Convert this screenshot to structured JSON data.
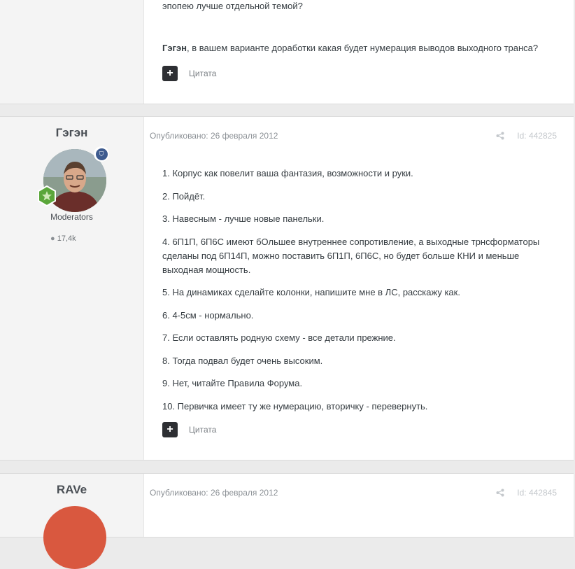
{
  "posts": [
    {
      "body_top": "эпопею лучше отдельной темой?",
      "reply_author": "Гэгэн",
      "reply_text": ", в вашем варианте доработки какая будет нумерация выводов выходного транса?",
      "quote_label": "Цитата"
    },
    {
      "author": "Гэгэн",
      "group": "Moderators",
      "posts_count": "17,4k",
      "date": "Опубликовано: 26 февраля 2012",
      "post_id": "Id: 442825",
      "paragraphs": [
        "1. Корпус как повелит ваша фантазия, возможности и руки.",
        "2. Пойдёт.",
        "3. Навесным - лучше новые панельки.",
        "4. 6П1П, 6П6С имеют бОльшее внутреннее сопротивление, а выходные трнсформаторы сделаны под 6П14П, можно поставить 6П1П, 6П6С, но будет больше КНИ и меньше выходная мощность.",
        "5. На динамиках сделайте колонки, напишите мне в ЛС, расскажу как.",
        "6. 4-5см - нормально.",
        "7. Если оставлять родную схему - все детали прежние.",
        "8. Тогда подвал будет очень высоким.",
        "9. Нет, читайте Правила Форума.",
        "10. Первичка имеет ту же нумерацию, вторичку - перевернуть."
      ],
      "quote_label": "Цитата"
    },
    {
      "author": "RAVe",
      "date": "Опубликовано: 26 февраля 2012",
      "post_id": "Id: 442845"
    }
  ],
  "icons": {
    "share": "share-icon",
    "plus": "plus-icon",
    "comment": "comment-icon",
    "moderator": "shield-icon",
    "rank": "star-icon"
  },
  "colors": {
    "page_bg": "#ebebeb",
    "aside_bg": "#f4f4f4",
    "badge_blue": "#3e5b8f",
    "rank_green": "#5aa63a",
    "avatar_rave": "#d9583f"
  }
}
